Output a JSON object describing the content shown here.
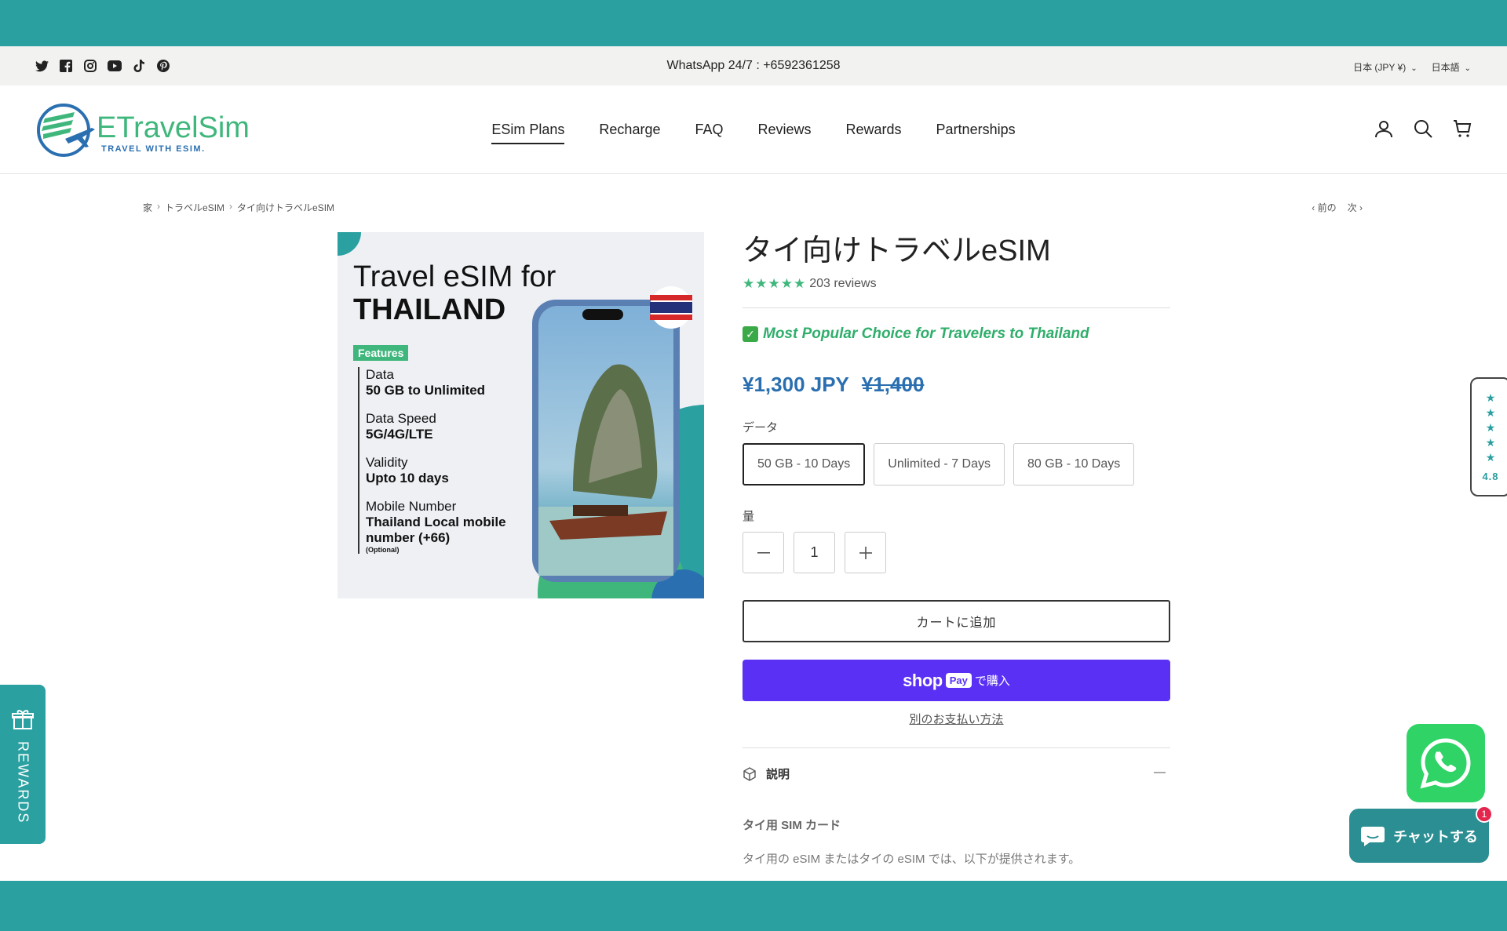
{
  "announcement": {
    "text": "WhatsApp 24/7 : +6592361258",
    "currency": "日本 (JPY ¥)",
    "language": "日本語",
    "social_icons": [
      "twitter-icon",
      "facebook-icon",
      "instagram-icon",
      "youtube-icon",
      "tiktok-icon",
      "pinterest-icon"
    ]
  },
  "header": {
    "logo_text": "ETravelSim",
    "logo_tagline": "TRAVEL WITH ESIM.",
    "nav": [
      "ESim Plans",
      "Recharge",
      "FAQ",
      "Reviews",
      "Rewards",
      "Partnerships"
    ],
    "active_nav": "ESim Plans"
  },
  "breadcrumb": {
    "items": [
      "家",
      "トラベルeSIM",
      "タイ向けトラベルeSIM"
    ],
    "prev": "前の",
    "next": "次"
  },
  "product_image": {
    "heading_line1": "Travel eSIM for",
    "heading_line2": "THAILAND",
    "features_badge": "Features",
    "features": [
      {
        "label": "Data",
        "value": "50 GB to Unlimited"
      },
      {
        "label": "Data Speed",
        "value": "5G/4G/LTE"
      },
      {
        "label": "Validity",
        "value": "Upto 10 days"
      },
      {
        "label": "Mobile Number",
        "value": "Thailand Local mobile number (+66)",
        "note": "(Optional)"
      }
    ]
  },
  "product": {
    "title": "タイ向けトラベルeSIM",
    "stars": "★★★★★",
    "reviews": "203 reviews",
    "tagline": "Most Popular Choice for Travelers to Thailand",
    "price": "¥1,300 JPY",
    "compare_price": "¥1,400",
    "data_label": "データ",
    "variants": [
      "50 GB - 10 Days",
      "Unlimited - 7 Days",
      "80 GB - 10 Days"
    ],
    "selected_variant": "50 GB - 10 Days",
    "quantity_label": "量",
    "quantity": "1",
    "add_to_cart": "カートに追加",
    "shoppay_shop": "shop",
    "shoppay_pay": "Pay",
    "shoppay_buy": "で購入",
    "alt_payment": "別のお支払い方法",
    "description_label": "説明",
    "description_subtitle": "タイ用 SIM カード",
    "description_text": "タイ用の eSIM またはタイの eSIM では、以下が提供されます。"
  },
  "widgets": {
    "rating_score": "4.8",
    "rewards_label": "REWARDS",
    "chat_label": "チャットする",
    "chat_badge": "1"
  },
  "colors": {
    "teal": "#2ba0a0",
    "price_blue": "#2a6fb0",
    "tagline_green": "#2fae6b",
    "shoppay_purple": "#5a31f4",
    "whatsapp_green": "#2fd366"
  }
}
